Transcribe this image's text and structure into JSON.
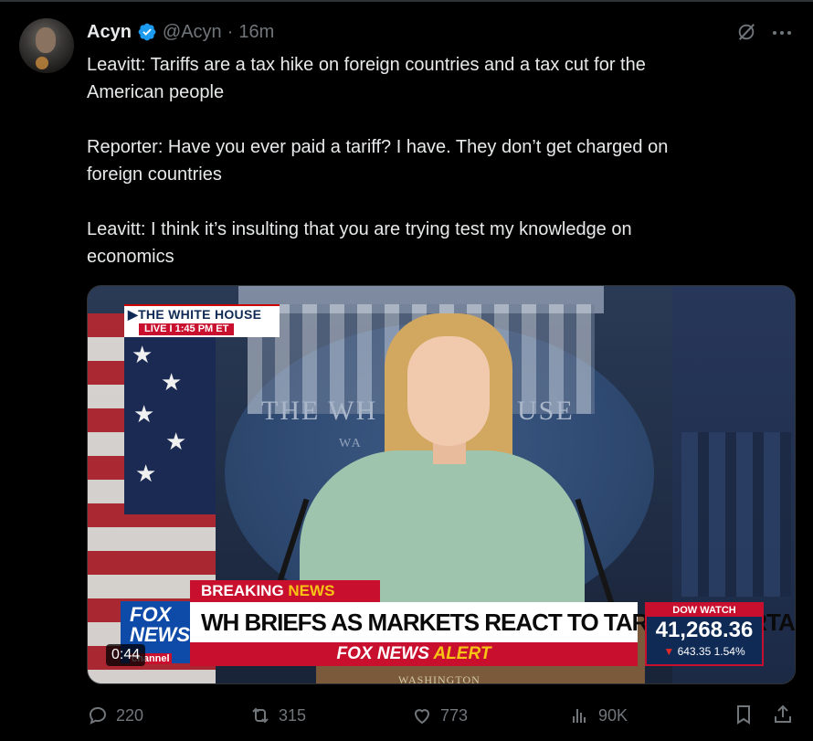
{
  "tweet": {
    "author_name": "Acyn",
    "handle": "@Acyn",
    "separator": "·",
    "time": "16m",
    "paragraphs": [
      "Leavitt: Tariffs are a tax hike on foreign countries and a tax cut for the\nAmerican people",
      "Reporter: Have you ever paid a tariff? I have. They don’t get charged on\nforeign countries",
      "Leavitt: I think it’s insulting that you are trying test my knowledge on\neconomics"
    ]
  },
  "video": {
    "duration": "0:44",
    "chyron_location": "THE WHITE HOUSE",
    "chyron_live": "LIVE  I  1:45 PM ET",
    "backdrop_left": "THE WH",
    "backdrop_right": "USE",
    "backdrop_sub": "WA",
    "breaking_label": "BREAKING",
    "breaking_news": "NEWS",
    "network_logo": "FOX\nNEWS",
    "network_channel": "channel",
    "headline": "WH BRIEFS AS MARKETS REACT TO TARIFF UNCERTAINTY",
    "alert_prefix": "FOX NEWS",
    "alert_suffix": "ALERT",
    "dow_label": "DOW WATCH",
    "dow_value": "41,268.36",
    "dow_change": "643.35",
    "dow_percent": "1.54%",
    "dateline": "WASHINGTON"
  },
  "actions": {
    "replies": "220",
    "reposts": "315",
    "likes": "773",
    "views": "90K"
  },
  "colors": {
    "background": "#000000",
    "text": "#e7e9ea",
    "muted": "#71767b",
    "verified": "#1d9bf0",
    "fox_red": "#c8102e"
  }
}
